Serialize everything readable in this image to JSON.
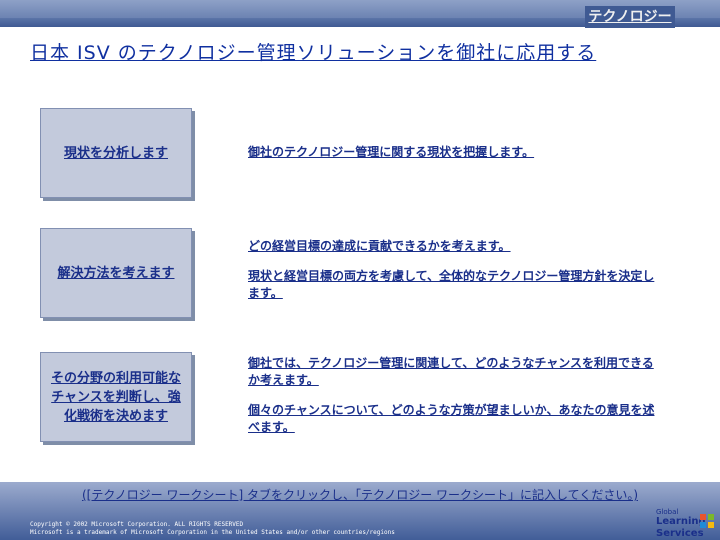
{
  "header": {
    "corner_tab": "テクノロジー"
  },
  "title": "日本 ISV のテクノロジー管理ソリューションを御社に応用する",
  "steps": [
    {
      "label": "現状を分析します"
    },
    {
      "label": "解決方法を考えます"
    },
    {
      "label": "その分野の利用可能なチャンスを判断し、強化戦術を決めます"
    }
  ],
  "descriptions": [
    "御社のテクノロジー管理に関する現状を把握します。",
    "どの経営目標の達成に貢献できるかを考えます。",
    "現状と経営目標の両方を考慮して、全体的なテクノロジー管理方針を決定します。",
    "御社では、テクノロジー管理に関連して、どのようなチャンスを利用できるか考えます。",
    "個々のチャンスについて、どのような方策が望ましいか、あなたの意見を述べます。"
  ],
  "footer": {
    "instruction": "([テクノロジー ワークシート] タブをクリックし、「テクノロジー ワークシート」に記入してください。)",
    "copyright_line1": "Copyright © 2002 Microsoft Corporation. ALL RIGHTS RESERVED",
    "copyright_line2": "Microsoft is a trademark of Microsoft Corporation in the United States and/or other countries/regions",
    "logo_line1": "Global",
    "logo_line2": "Learning",
    "logo_line3": "Services"
  },
  "icons": {
    "logo_mark": "microsoft-logo-icon"
  },
  "colors": {
    "text": "#1a2f8a",
    "title": "#1030a0",
    "box_fill": "#c3cadc",
    "header": "#5b74a8"
  }
}
